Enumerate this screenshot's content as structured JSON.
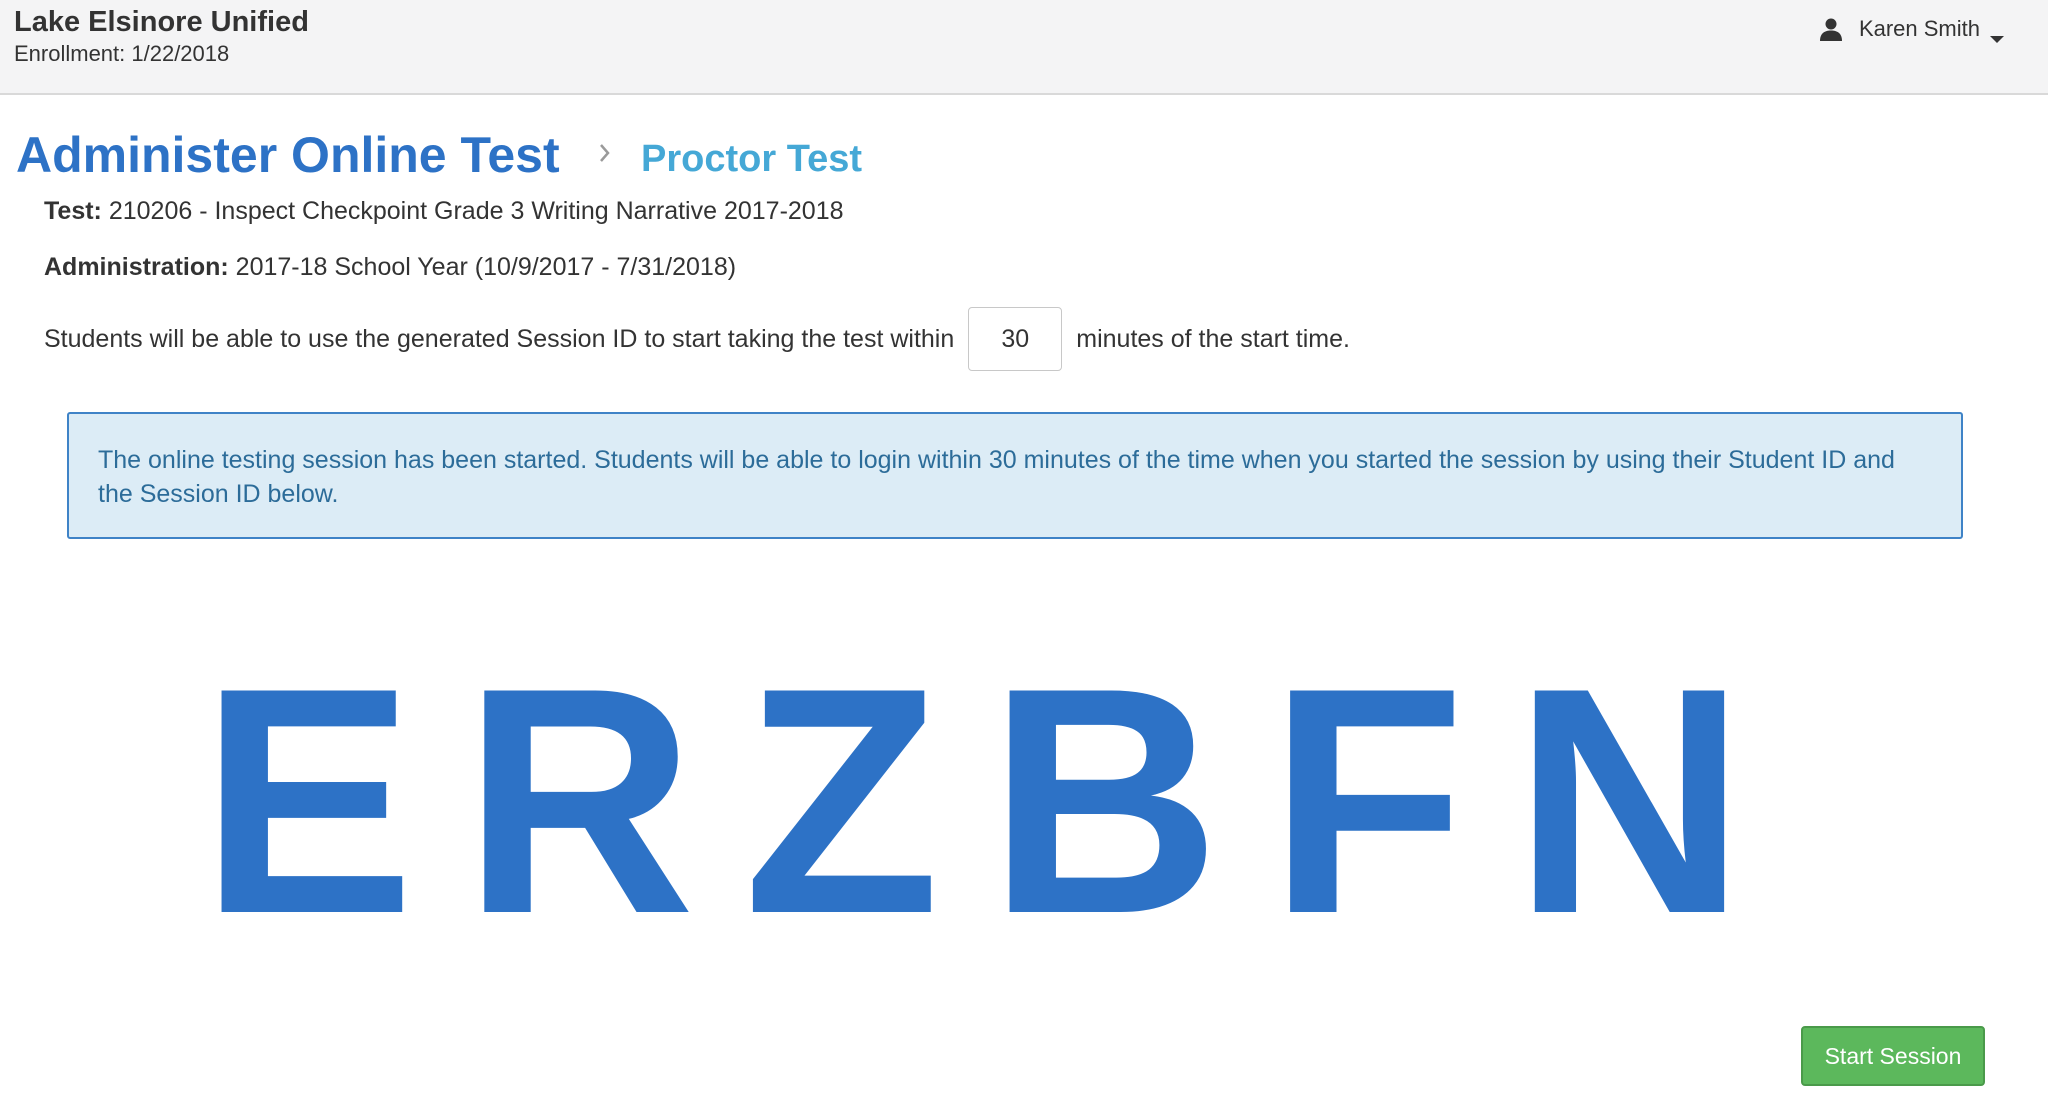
{
  "header": {
    "org_name": "Lake Elsinore Unified",
    "enrollment": "Enrollment: 1/22/2018",
    "user": {
      "name": "Karen Smith",
      "icon": "user-icon",
      "dropdown_icon": "caret-down-icon"
    }
  },
  "breadcrumb": {
    "title": "Administer Online Test",
    "separator_icon": "chevron-right-icon",
    "current": "Proctor Test"
  },
  "test": {
    "label": "Test:",
    "value": "210206 - Inspect Checkpoint Grade 3 Writing Narrative 2017-2018"
  },
  "administration": {
    "label": "Administration:",
    "value": "2017-18 School Year (10/9/2017 - 7/31/2018)"
  },
  "session_window": {
    "text_before": "Students will be able to use the generated Session ID to start taking the test within",
    "minutes": "30",
    "text_after": "minutes of the start time."
  },
  "alert": {
    "message": "The online testing session has been started. Students will be able to login within 30 minutes of the time when you started the session by using their Student ID and the Session ID below."
  },
  "session_id": {
    "characters": [
      "E",
      "R",
      "Z",
      "B",
      "F",
      "N"
    ]
  },
  "actions": {
    "start_session": "Start Session"
  },
  "colors": {
    "title_blue": "#2d72c6",
    "breadcrumb_light_blue": "#45a8d6",
    "alert_background": "#dcecf6",
    "alert_border": "#3f83c7",
    "alert_text": "#2c6c99",
    "button_green": "#5cb85c",
    "header_background": "#f4f4f5"
  }
}
